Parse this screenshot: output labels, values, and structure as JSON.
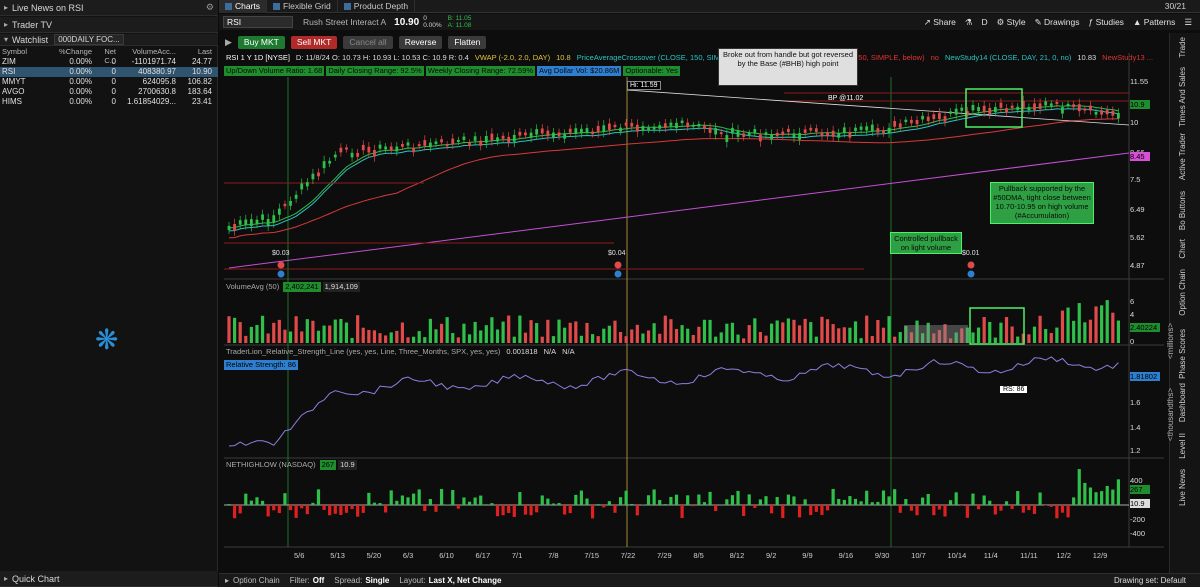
{
  "left": {
    "live_news": "Live News on RSI",
    "trader_tv": "Trader TV",
    "watchlist_label": "Watchlist",
    "watchlist_name": "000DAILY FOC...",
    "columns": [
      "Symbol",
      "%Change",
      "Net C...",
      "VolumeAcc...",
      "Last"
    ],
    "rows": [
      {
        "sym": "ZIM",
        "chg": "0.00%",
        "net": "0",
        "vol": "-1101971.74",
        "last": "24.77"
      },
      {
        "sym": "RSI",
        "chg": "0.00%",
        "net": "0",
        "vol": "408380.97",
        "last": "10.90"
      },
      {
        "sym": "MMYT",
        "chg": "0.00%",
        "net": "0",
        "vol": "624095.8",
        "last": "106.82"
      },
      {
        "sym": "AVGO",
        "chg": "0.00%",
        "net": "0",
        "vol": "2700630.8",
        "last": "183.64"
      },
      {
        "sym": "HIMS",
        "chg": "0.00%",
        "net": "0",
        "vol": "1.61854029...",
        "last": "23.41"
      }
    ],
    "quick_chart": "Quick Chart"
  },
  "tabs": [
    "Charts",
    "Flexible Grid",
    "Product Depth"
  ],
  "date_right": "30/21",
  "toolbar": {
    "symbol": "RSI",
    "company": "Rush Street Interact A",
    "price": "10.90",
    "change": "0",
    "change_pct": "0.00%",
    "bid": "B: 11.05",
    "ask": "A: 11.08",
    "buttons": [
      "Share",
      "D",
      "Style",
      "Drawings",
      "Studies",
      "Patterns"
    ]
  },
  "orders": {
    "buy": "Buy MKT",
    "sell": "Sell MKT",
    "cancel": "Cancel all",
    "reverse": "Reverse",
    "flatten": "Flatten"
  },
  "chart": {
    "header": "RSI 1 Y 1D [NYSE]",
    "ohlc": "D: 11/8/24   O: 10.73   H: 10.93   L: 10.53   C: 10.9   R: 0.4",
    "vwap": "VWAP (-2.0, 2.0, DAY)",
    "vwap_val": "10.8",
    "pac": "PriceAverageCrossover (CLOSE, 150, SIMPLE, above)",
    "pac_val": "no",
    "ns10": "NewStudy10 (CLOSE, 50, SIMPLE, below)",
    "ns10_val": "no",
    "ns14": "NewStudy14 (CLOSE, DAY, 21, 0, no)",
    "ns14_val": "10.83",
    "ns13": "NewStudy13 ...",
    "labels": [
      {
        "t": "Up/Down Volume Ratio: 1.68",
        "c": "#1f8c2e"
      },
      {
        "t": "Daily Closing Range: 92.5%",
        "c": "#1f8c2e"
      },
      {
        "t": "Weekly Closing Range: 72.59%",
        "c": "#1f8c2e"
      },
      {
        "t": "Avg Dollar Vol: $20.86M",
        "c": "#2f7fd0"
      },
      {
        "t": "Optionable: Yes",
        "c": "#1f8c2e"
      }
    ],
    "hi_label": "Hi: 11.59",
    "bp_label": "BP @11.02",
    "ann1": "Broke out from handle but got reversed by the Base (#BHB) high point",
    "ann2": "Pullback supported by the #50DMA, tight close between 10.70-10.95 on high volume (#Accumulation)",
    "ann3": "Controlled pullback on light volume",
    "div_labels": [
      "$0.03",
      "$0.04",
      "$0.01"
    ],
    "price_axis": [
      "11.55",
      "10.9",
      "10",
      "8.45",
      "8.66",
      "7.5",
      "6.49",
      "5.62",
      "4.87"
    ],
    "price_flag": "10.9",
    "price_flag2": "8.45",
    "volume": {
      "label": "VolumeAvg (50)",
      "v1": "2,402,241",
      "v2": "1,914,109",
      "axis": [
        "6",
        "4",
        "2",
        "0"
      ],
      "flag": "2.40224",
      "unit": "<millions>"
    },
    "rsline": {
      "label": "TraderLion_Relative_Strength_Line (yes, yes, Line, Three_Months, SPX, yes, yes)",
      "val": "0.001818",
      "na1": "N/A",
      "na2": "N/A",
      "rs_label": "Relative Strength: 86",
      "rs_tag": "RS: 86",
      "axis": [
        "1.8",
        "1.6",
        "1.4",
        "1.2"
      ],
      "flag": "1.81802",
      "unit": "<thousandths>"
    },
    "nhl": {
      "label": "NETHIGHLOW (NASDAQ)",
      "v1": "267",
      "v2": "10.9",
      "axis": [
        "400",
        "200",
        "-200",
        "-400"
      ],
      "flag": "267",
      "flag2": "10.9"
    },
    "x_axis": [
      "5/6",
      "5/13",
      "5/20",
      "6/3",
      "6/10",
      "6/17",
      "7/1",
      "7/8",
      "7/15",
      "7/22",
      "7/29",
      "8/5",
      "8/12",
      "9/2",
      "9/9",
      "9/16",
      "9/30",
      "10/7",
      "10/14",
      "11/4",
      "11/11",
      "12/2",
      "12/9"
    ]
  },
  "right_strip": [
    "Trade",
    "Times And Sales",
    "Active Trader",
    "Bo Buttons",
    "Chart",
    "Option Chain",
    "Phase Scores",
    "Dashboard",
    "Level II",
    "Live News"
  ],
  "bottom": {
    "option_chain": "Option Chain",
    "filter_label": "Filter:",
    "filter": "Off",
    "spread_label": "Spread:",
    "spread": "Single",
    "layout_label": "Layout:",
    "layout": "Last X, Net Change",
    "drawing_set": "Drawing set: Default"
  }
}
